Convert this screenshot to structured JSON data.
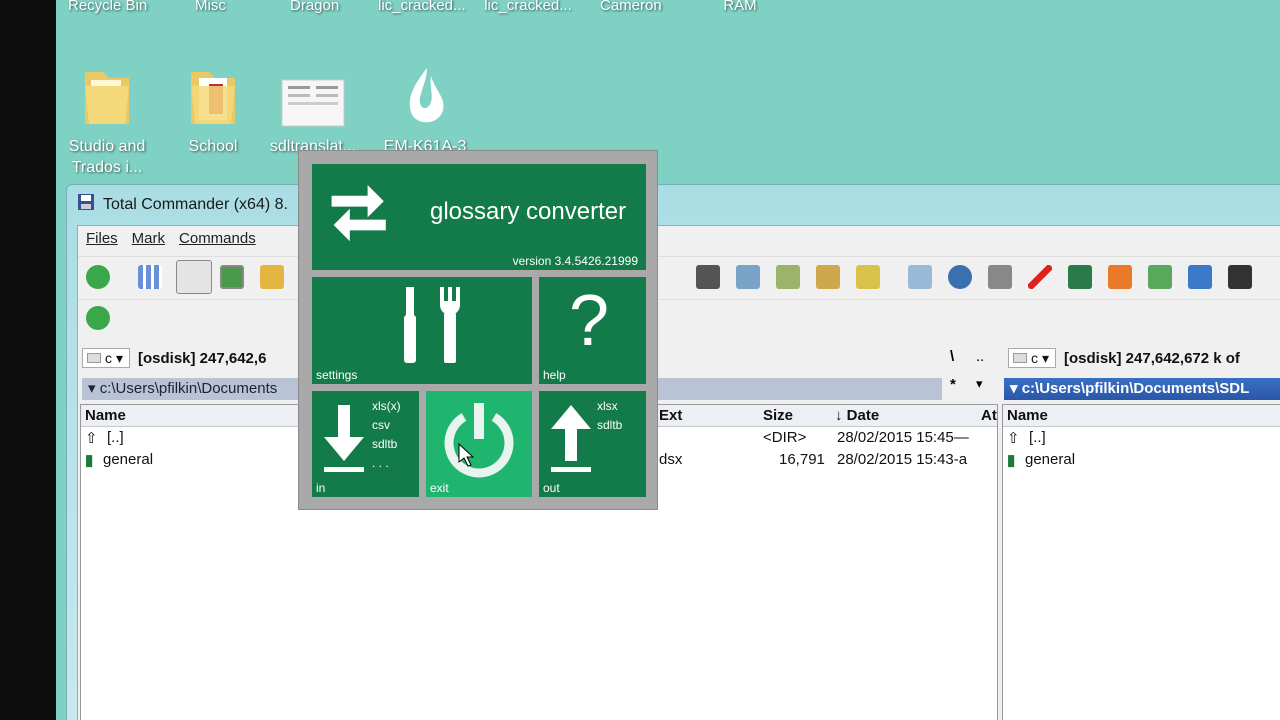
{
  "desktop": {
    "top_labels": [
      "Recycle Bin",
      "Misc",
      "Dragon",
      "lic_cracked...",
      "no lic_cracked...",
      "Cameron",
      "Clear Unused RAM"
    ],
    "icons": [
      {
        "label": "Studio and Trados i...",
        "type": "folder-icon"
      },
      {
        "label": "School",
        "type": "folder-icon"
      },
      {
        "label": "sdltranslat...",
        "type": "document-icon"
      },
      {
        "label": "EM-K61A-3",
        "type": "dragon-icon"
      }
    ]
  },
  "total_commander": {
    "title": "Total Commander (x64) 8.",
    "menu": [
      "Files",
      "Mark",
      "Commands"
    ],
    "left": {
      "drive": "c",
      "disk_info": "[osdisk]  247,642,6",
      "path": "▾ c:\\Users\\pfilkin\\Documents",
      "columns": {
        "name": "Name",
        "ext": "Ext",
        "size": "Size",
        "date": "↓ Date",
        "attr": "At"
      },
      "rows": [
        {
          "name": "[..]",
          "ext": "",
          "size": "<DIR>",
          "date": "28/02/2015 15:45—"
        },
        {
          "name": "general",
          "ext": "dsx",
          "size": "16,791",
          "date": "28/02/2015 15:43-a"
        }
      ],
      "nav_root": "\\",
      "nav_up": "..",
      "nav_star": "*"
    },
    "right": {
      "drive": "c",
      "disk_info": "[osdisk]  247,642,672 k of",
      "path": "▾ c:\\Users\\pfilkin\\Documents\\SDL",
      "columns": {
        "name": "Name"
      },
      "rows": [
        {
          "name": "[..]"
        },
        {
          "name": "general"
        }
      ]
    }
  },
  "glossary_converter": {
    "title": "glossary converter",
    "version": "version 3.4.5426.21999",
    "tiles": {
      "settings": "settings",
      "help": "help",
      "help_glyph": "?",
      "in": "in",
      "in_formats": [
        "xls(x)",
        "csv",
        "sdltb",
        ". . ."
      ],
      "exit": "exit",
      "out": "out",
      "out_formats": [
        "xlsx",
        "sdltb"
      ]
    },
    "colors": {
      "tile": "#137a4a",
      "tile_hover": "#1fb56f"
    }
  }
}
